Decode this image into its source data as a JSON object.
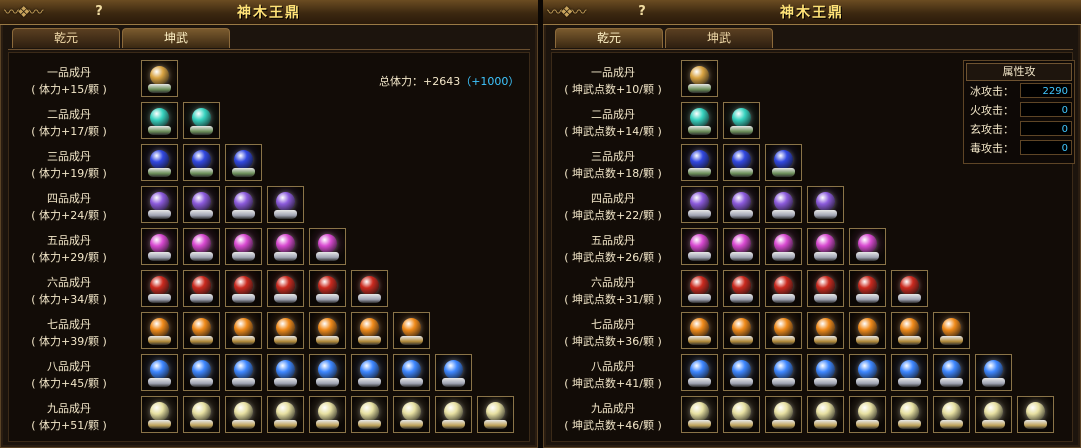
{
  "colors": {
    "grades": [
      "#d9a443",
      "#38d3c0",
      "#3148e0",
      "#8c5bdc",
      "#d84ad1",
      "#cb2a1f",
      "#f08b1b",
      "#3e87ff",
      "#e7e0a2"
    ],
    "bases": [
      "#6c8f5a",
      "#6c8f5a",
      "#6c8f5a",
      "#a0a4b3",
      "#a0a4b3",
      "#a0a4b3",
      "#b38b3a",
      "#a0a4b3",
      "#bfa35a"
    ],
    "stat_extra": "#3ec6ff",
    "title": "#ffe277"
  },
  "left": {
    "help_label": "?",
    "title": "神木王鼎",
    "tabs": [
      {
        "label": "乾元"
      },
      {
        "label": "坤武"
      }
    ],
    "stat": {
      "label": "总体力：+2643",
      "extra": "（+1000）"
    },
    "grades": [
      {
        "name": "一品成丹",
        "bonus": "( 体力+15/颗 )",
        "count": 1
      },
      {
        "name": "二品成丹",
        "bonus": "( 体力+17/颗 )",
        "count": 2
      },
      {
        "name": "三品成丹",
        "bonus": "( 体力+19/颗 )",
        "count": 3
      },
      {
        "name": "四品成丹",
        "bonus": "( 体力+24/颗 )",
        "count": 4
      },
      {
        "name": "五品成丹",
        "bonus": "( 体力+29/颗 )",
        "count": 5
      },
      {
        "name": "六品成丹",
        "bonus": "( 体力+34/颗 )",
        "count": 6
      },
      {
        "name": "七品成丹",
        "bonus": "( 体力+39/颗 )",
        "count": 7
      },
      {
        "name": "八品成丹",
        "bonus": "( 体力+45/颗 )",
        "count": 8
      },
      {
        "name": "九品成丹",
        "bonus": "( 体力+51/颗 )",
        "count": 9
      }
    ]
  },
  "right": {
    "help_label": "?",
    "title": "神木王鼎",
    "tabs": [
      {
        "label": "乾元"
      },
      {
        "label": "坤武"
      }
    ],
    "attr_panel": {
      "title": "属性攻",
      "rows": [
        {
          "label": "冰攻击：",
          "value": "2290"
        },
        {
          "label": "火攻击：",
          "value": "0"
        },
        {
          "label": "玄攻击：",
          "value": "0"
        },
        {
          "label": "毒攻击：",
          "value": "0"
        }
      ]
    },
    "grades": [
      {
        "name": "一品成丹",
        "bonus": "( 坤武点数+10/颗 )",
        "count": 1
      },
      {
        "name": "二品成丹",
        "bonus": "( 坤武点数+14/颗 )",
        "count": 2
      },
      {
        "name": "三品成丹",
        "bonus": "( 坤武点数+18/颗 )",
        "count": 3
      },
      {
        "name": "四品成丹",
        "bonus": "( 坤武点数+22/颗 )",
        "count": 4
      },
      {
        "name": "五品成丹",
        "bonus": "( 坤武点数+26/颗 )",
        "count": 5
      },
      {
        "name": "六品成丹",
        "bonus": "( 坤武点数+31/颗 )",
        "count": 6
      },
      {
        "name": "七品成丹",
        "bonus": "( 坤武点数+36/颗 )",
        "count": 7
      },
      {
        "name": "八品成丹",
        "bonus": "( 坤武点数+41/颗 )",
        "count": 8
      },
      {
        "name": "九品成丹",
        "bonus": "( 坤武点数+46/颗 )",
        "count": 9
      }
    ]
  }
}
